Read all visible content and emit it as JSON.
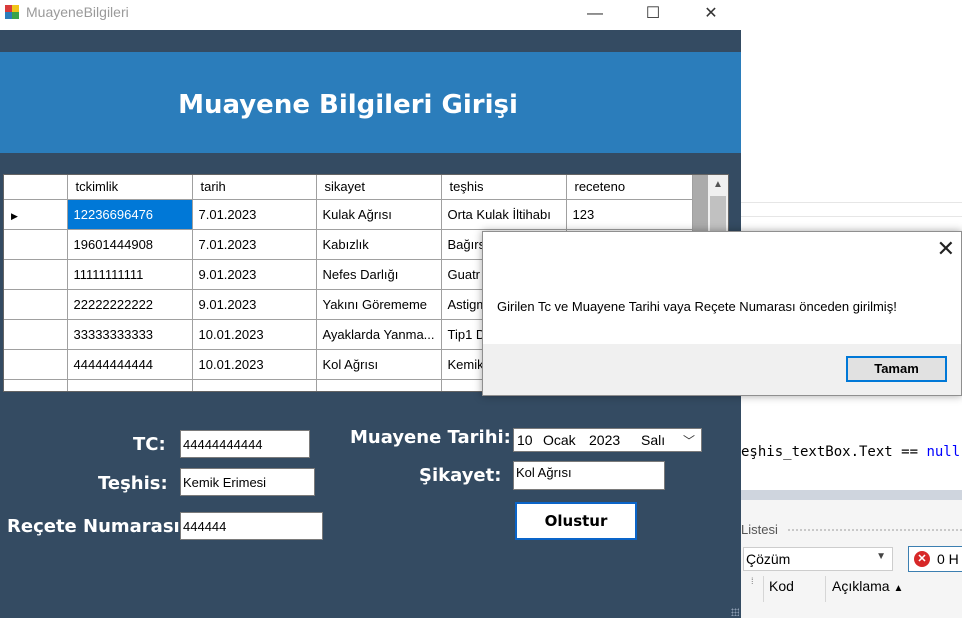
{
  "window": {
    "title": "MuayeneBilgileri",
    "minimize_glyph": "—",
    "maximize_glyph": "☐",
    "close_glyph": "✕"
  },
  "header": {
    "title": "Muayene Bilgileri Girişi"
  },
  "grid": {
    "columns": [
      "tckimlik",
      "tarih",
      "sikayet",
      "teşhis",
      "receteno"
    ],
    "rows": [
      [
        "12236696476",
        "7.01.2023",
        "Kulak Ağrısı",
        "Orta Kulak İltihabı",
        "123"
      ],
      [
        "19601444908",
        "7.01.2023",
        "Kabızlık",
        "Bağırsak",
        ""
      ],
      [
        "11111111111",
        "9.01.2023",
        "Nefes Darlığı",
        "Guatr",
        ""
      ],
      [
        "22222222222",
        "9.01.2023",
        "Yakını Görememe",
        "Astigmat",
        ""
      ],
      [
        "33333333333",
        "10.01.2023",
        "Ayaklarda Yanma...",
        "Tip1 D",
        ""
      ],
      [
        "44444444444",
        "10.01.2023",
        "Kol Ağrısı",
        "Kemik",
        ""
      ]
    ],
    "current_row_marker": "▶",
    "scroll_up_glyph": "▲"
  },
  "form": {
    "tc_label": "TC:",
    "tc_value": "44444444444",
    "teshis_label": "Teşhis:",
    "teshis_value": "Kemik Erimesi",
    "recete_label": "Reçete Numarası:",
    "recete_value": "444444",
    "tarih_label": "Muayene Tarihi:",
    "date_day": "10",
    "date_month": "Ocak",
    "date_year": "2023",
    "date_weekday": "Salı",
    "sikayet_label": "Şikayet:",
    "sikayet_value": "Kol Ağrısı",
    "create_button": "Olustur"
  },
  "message_box": {
    "text": "Girilen Tc ve Muayene Tarihi vaya Reçete Numarası önceden girilmiş!",
    "ok_button": "Tamam",
    "close_glyph": "✕"
  },
  "ide": {
    "code_line": "eşhis_textBox.Text == ",
    "code_keyword": "null",
    "panel_title": "Listesi",
    "filter_value": "Çözüm",
    "error_count": "0 H",
    "col_kod": "Kod",
    "col_aciklama": "Açıklama"
  }
}
